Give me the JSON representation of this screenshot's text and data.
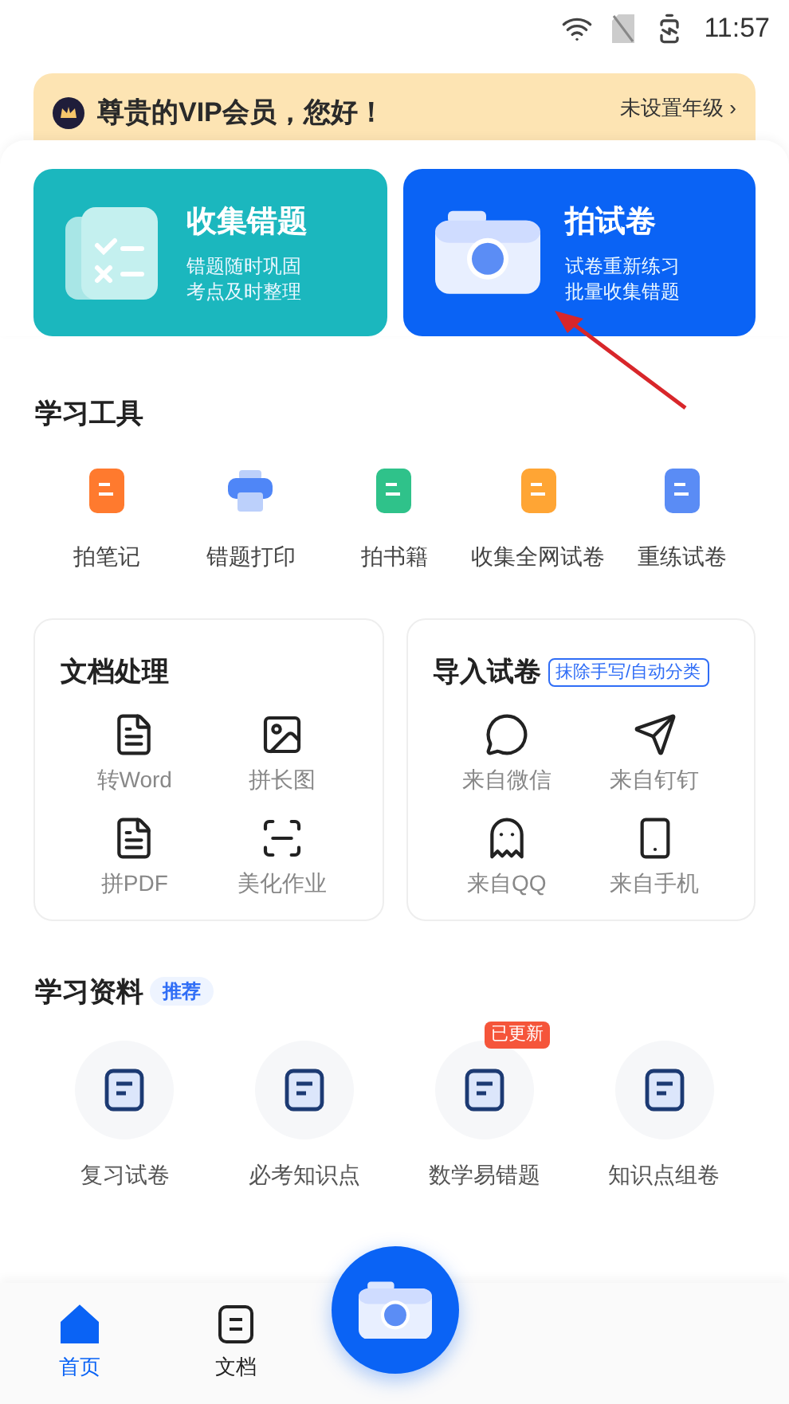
{
  "status_bar": {
    "time": "11:57"
  },
  "vip_banner": {
    "greeting": "尊贵的VIP会员，您好！",
    "grade_link": "未设置年级",
    "chevron": "›"
  },
  "feature_cards": [
    {
      "kind": "collect",
      "title": "收集错题",
      "lines": [
        "错题随时巩固",
        "考点及时整理"
      ]
    },
    {
      "kind": "camera",
      "title": "拍试卷",
      "lines": [
        "试卷重新练习",
        "批量收集错题"
      ]
    }
  ],
  "tools": {
    "title": "学习工具",
    "items": [
      "拍笔记",
      "错题打印",
      "拍书籍",
      "收集全网试卷",
      "重练试卷"
    ]
  },
  "doc_panel": {
    "title": "文档处理",
    "items": [
      "转Word",
      "拼长图",
      "拼PDF",
      "美化作业"
    ]
  },
  "import_panel": {
    "title": "导入试卷",
    "badge": "抹除手写/自动分类",
    "items": [
      "来自微信",
      "来自钉钉",
      "来自QQ",
      "来自手机"
    ]
  },
  "materials": {
    "title": "学习资料",
    "badge": "推荐",
    "items": [
      {
        "label": "复习试卷"
      },
      {
        "label": "必考知识点"
      },
      {
        "label": "数学易错题",
        "badge": "已更新"
      },
      {
        "label": "知识点组卷"
      }
    ]
  },
  "bottom_nav": {
    "tabs": [
      {
        "label": "首页",
        "selected": true
      },
      {
        "label": "文档",
        "selected": false
      }
    ]
  }
}
